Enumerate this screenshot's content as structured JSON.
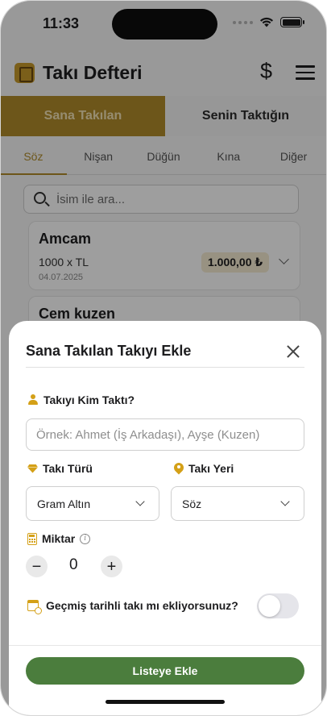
{
  "status_bar": {
    "time": "11:33"
  },
  "header": {
    "title": "Takı Defteri"
  },
  "segment": {
    "tabs": [
      "Sana Takılan",
      "Senin Taktığın"
    ],
    "active": 0
  },
  "subtabs": {
    "items": [
      "Söz",
      "Nişan",
      "Düğün",
      "Kına",
      "Diğer"
    ],
    "active": 0
  },
  "search": {
    "placeholder": "İsim ile ara..."
  },
  "list": {
    "items": [
      {
        "name": "Amcam",
        "quantity": "1000 x TL",
        "date": "04.07.2025",
        "amount": "1.000,00 ₺"
      },
      {
        "name": "Cem kuzen"
      }
    ]
  },
  "sheet": {
    "title": "Sana Takılan Takıyı Ekle",
    "who_label": "Takıyı Kim Taktı?",
    "who_placeholder": "Örnek: Ahmet (İş Arkadaşı), Ayşe (Kuzen)",
    "type_label": "Takı Türü",
    "type_value": "Gram Altın",
    "place_label": "Takı Yeri",
    "place_value": "Söz",
    "amount_label": "Miktar",
    "amount_value": "0",
    "minus": "−",
    "plus": "+",
    "past_date_label": "Geçmiş tarihli takı mı ekliyorsunuz?",
    "past_date_enabled": false,
    "submit": "Listeye Ekle"
  },
  "colors": {
    "gold": "#b08c2a",
    "accent_icon": "#d4a017",
    "primary_button": "#4b7d3d"
  },
  "icons": [
    "ring-book-logo-icon",
    "dollar-icon",
    "menu-icon",
    "search-icon",
    "chevron-down-icon",
    "close-icon",
    "person-icon",
    "diamond-icon",
    "pin-icon",
    "calculator-icon",
    "info-icon",
    "calendar-clock-icon"
  ]
}
